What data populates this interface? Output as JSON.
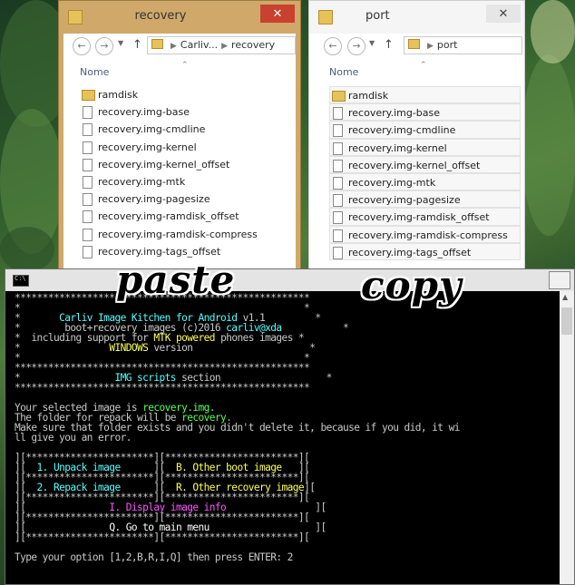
{
  "recovery_window": {
    "title": "recovery",
    "path": [
      "Carliv...",
      "recovery"
    ],
    "column_header": "Nome",
    "files": [
      "ramdisk",
      "recovery.img-base",
      "recovery.img-cmdline",
      "recovery.img-kernel",
      "recovery.img-kernel_offset",
      "recovery.img-mtk",
      "recovery.img-pagesize",
      "recovery.img-ramdisk_offset",
      "recovery.img-ramdisk-compress",
      "recovery.img-tags_offset"
    ],
    "close_glyph": "✕"
  },
  "port_window": {
    "title": "port",
    "path": [
      "port"
    ],
    "column_header": "Nome",
    "files": [
      "ramdisk",
      "recovery.img-base",
      "recovery.img-cmdline",
      "recovery.img-kernel",
      "recovery.img-kernel_offset",
      "recovery.img-mtk",
      "recovery.img-pagesize",
      "recovery.img-ramdisk_offset",
      "recovery.img-ramdisk-compress",
      "recovery.img-tags_offset"
    ],
    "close_glyph": "✕"
  },
  "overlay_words": {
    "paste": "paste",
    "copy": "copy"
  },
  "console": {
    "border_row": "*****************************************************",
    "banner": {
      "title": "Carliv Image Kitchen for Android",
      "version": "v1.1",
      "line2_a": "boot+recovery images (c)2016",
      "line2_author": "carliv@xda",
      "line3_a": "including support for",
      "line3_mtk": "MTK powered",
      "line3_b": "phones images",
      "windows": "WINDOWS",
      "version_word": "version"
    },
    "section_title": "IMG scripts",
    "section_word": "section",
    "msg1_a": "Your selected image is",
    "msg1_val": "recovery.img.",
    "msg2_a": "The folder for repack will be",
    "msg2_val": "recovery.",
    "msg3": "Make sure that folder exists and you didn't delete it, because if you did, it wi",
    "msg4": "ll give you an error.",
    "menu": {
      "opt1": "1. Unpack image",
      "optB": "B. Other boot image",
      "opt2": "2. Repack image",
      "optR": "R. Other recovery image",
      "optI": "I. Display image info",
      "optQ": "Q. Go to main menu"
    },
    "prompt": "Type your option [1,2,B,R,I,Q] then press ENTER: 2"
  }
}
